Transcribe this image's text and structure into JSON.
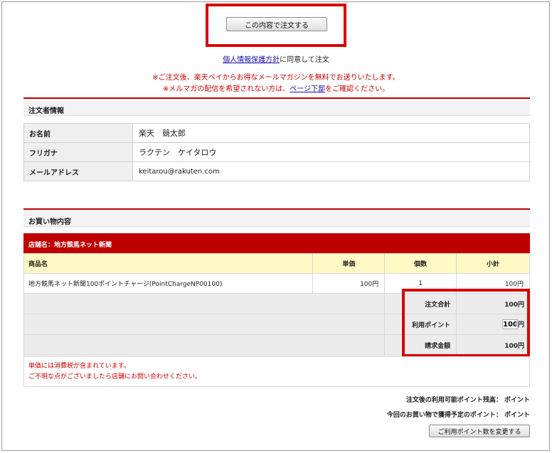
{
  "order_button": "この内容で注文する",
  "agree": {
    "link": "個人情報保護方針",
    "text": "に同意して注文"
  },
  "notice": {
    "line1": "※ご注文後、楽天ペイからお得なメールマガジンを無料でお送りいたします。",
    "line2_pre": "※メルマガの配信を希望されない方は、",
    "line2_link": "ページ下部",
    "line2_post": "をご確認ください。"
  },
  "buyer": {
    "title": "注文者情報",
    "rows": [
      {
        "label": "お名前",
        "value": "楽天　競太郎"
      },
      {
        "label": "フリガナ",
        "value": "ラクテン　ケイタロウ"
      },
      {
        "label": "メールアドレス",
        "value": "keitarou@rakuten.com"
      }
    ]
  },
  "cart": {
    "title": "お買い物内容",
    "store": "店舗名：地方競馬ネット新聞",
    "headers": {
      "name": "商品名",
      "price": "単価",
      "qty": "個数",
      "subtotal": "小計"
    },
    "item": {
      "name": "地方競馬ネット新聞100ポイントチャージ(PointChargeNP00100)",
      "price": "100円",
      "qty": "1",
      "subtotal": "100円"
    },
    "summary": {
      "total_label": "注文合計",
      "total_value": "100円",
      "points_label": "利用ポイント",
      "points_value": "100",
      "points_unit": "円",
      "billing_label": "請求金額",
      "billing_value": "100円"
    },
    "tax_note1": "単価には消費税が含まれています。",
    "tax_note2": "ご不明な点がございましたら店舗にお問い合わせください。"
  },
  "points": {
    "balance": "注文後の利用可能ポイント残高：  ポイント",
    "earned": "今回のお買い物で獲得予定のポイント：  ポイント",
    "change_button": "ご利用ポイント数を変更する"
  },
  "colors": {
    "accent": "#bf0000",
    "header_yellow": "#fff9c4",
    "link": "#1a0dab"
  }
}
